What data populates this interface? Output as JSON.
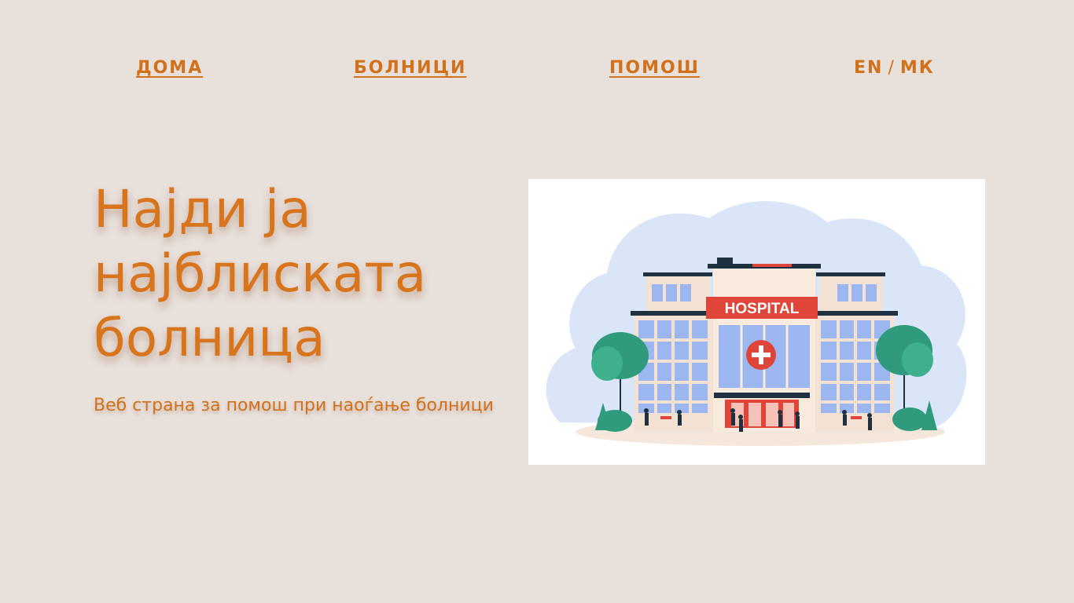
{
  "nav": {
    "home": "ДОМА",
    "hospitals": "БОЛНИЦИ",
    "help": "ПОМОШ",
    "lang_en": "EN",
    "lang_sep": "/",
    "lang_mk": "МК"
  },
  "hero": {
    "title_line1": "Најди ја",
    "title_line2": "најблиската",
    "title_line3": "болница",
    "subtitle": "Веб страна за помош при наоѓање болници"
  },
  "illustration": {
    "sign_text": "HOSPITAL"
  },
  "colors": {
    "background": "#e8e0db",
    "accent": "#d2711b",
    "sign_red": "#e0453a",
    "window_blue": "#9cb6ef",
    "tree_green": "#2f9a7c"
  }
}
